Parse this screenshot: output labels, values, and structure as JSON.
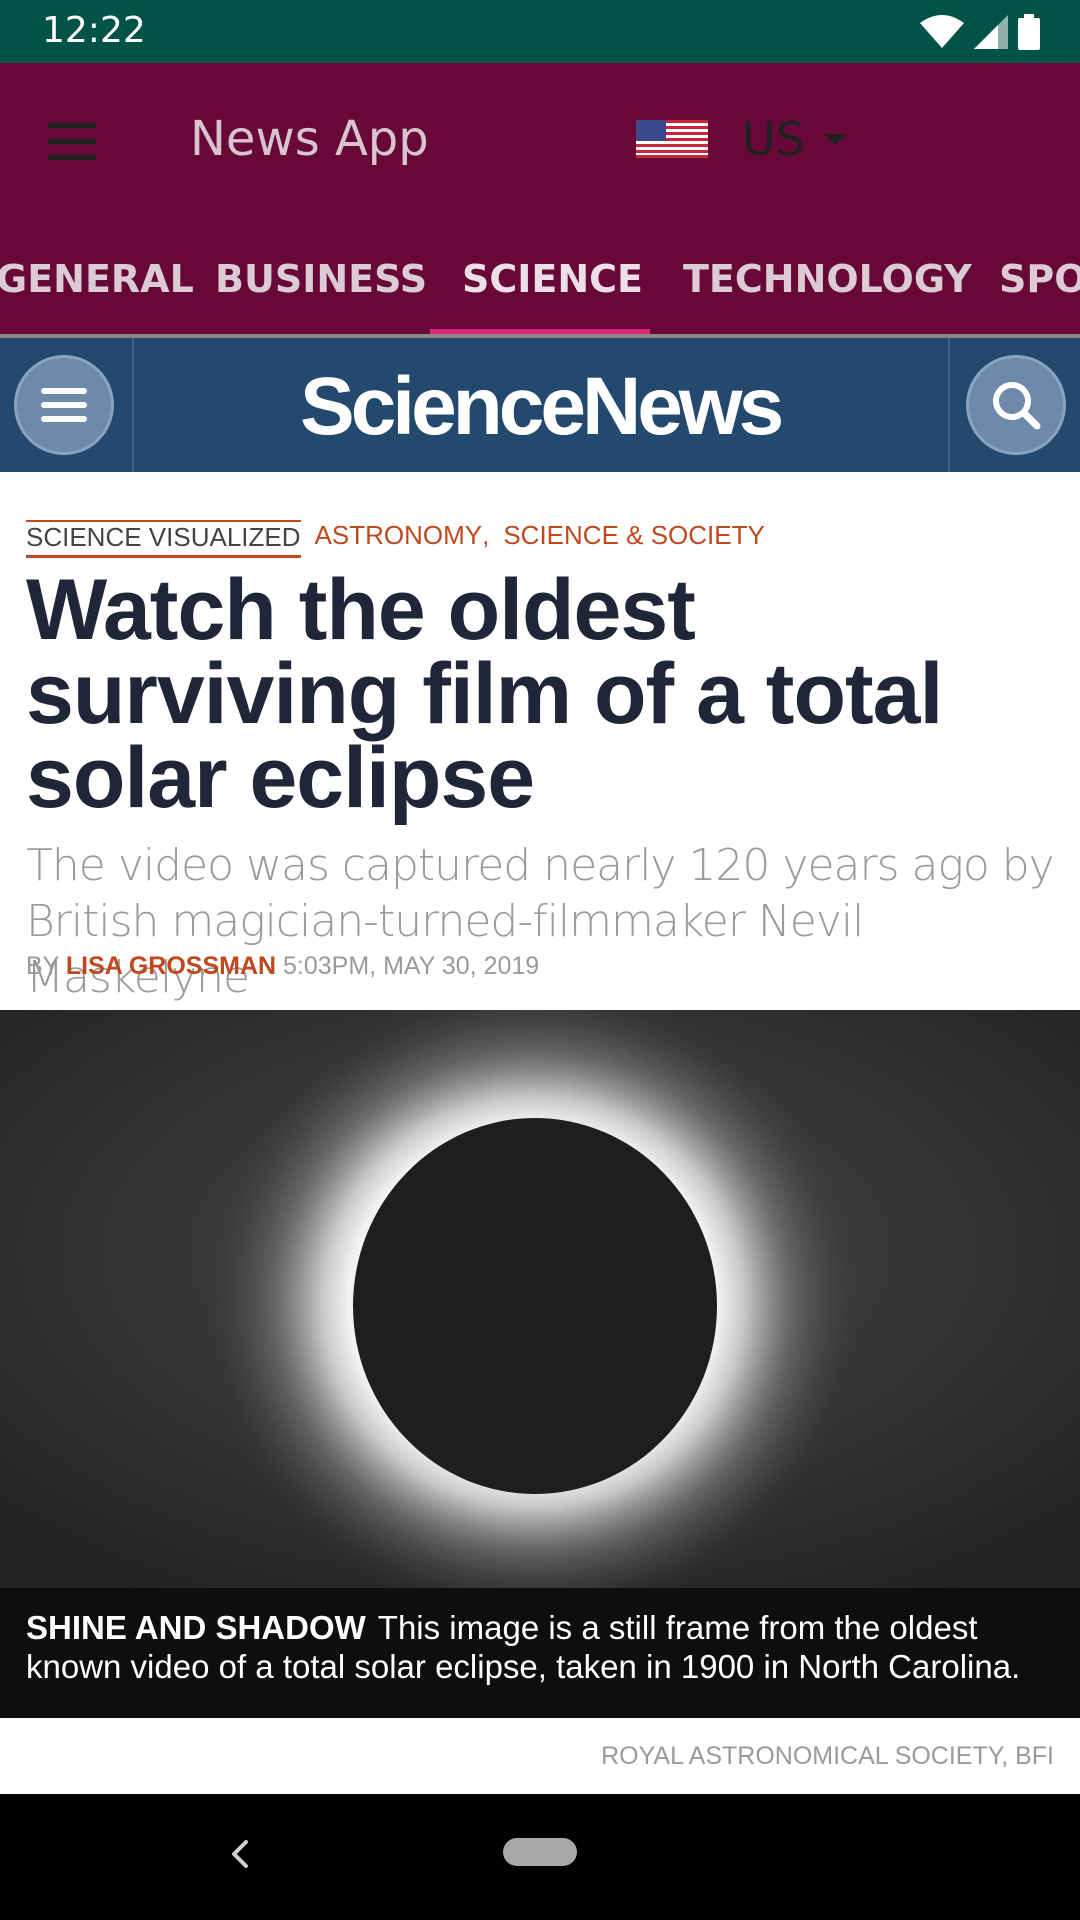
{
  "status_bar": {
    "time": "12:22"
  },
  "app_bar": {
    "title": "News App",
    "country": "US",
    "tabs": [
      "GENERAL",
      "BUSINESS",
      "SCIENCE",
      "TECHNOLOGY",
      "SPORTS"
    ],
    "active_tab": "SCIENCE"
  },
  "site": {
    "logo": "ScienceNews"
  },
  "article": {
    "category_primary": "SCIENCE VISUALIZED",
    "categories": [
      "ASTRONOMY",
      "SCIENCE & SOCIETY"
    ],
    "headline": "Watch the oldest surviving film of a total solar eclipse",
    "dek": "The video was captured nearly 120 years ago by British magician-turned-filmmaker Nevil Maskelyne",
    "byline_prefix": "BY",
    "author": "LISA GROSSMAN",
    "timestamp": "5:03PM, MAY 30, 2019",
    "caption_title": "SHINE AND SHADOW",
    "caption_text": "This image is a still frame from the oldest known video of a total solar eclipse, taken in 1900 in North Carolina.",
    "credit": "ROYAL ASTRONOMICAL SOCIETY, BFI"
  },
  "icons": {
    "status": [
      "wifi-icon",
      "signal-icon",
      "battery-icon"
    ],
    "menu": "hamburger-icon",
    "search": "search-icon",
    "back": "back-icon",
    "home": "home-pill-icon"
  },
  "colors": {
    "status_bar": "#005346",
    "app_bar": "#680839",
    "tab_indicator": "#e0267a",
    "site_header": "#24496f",
    "accent": "#c0481e",
    "headline": "#1e2638"
  }
}
